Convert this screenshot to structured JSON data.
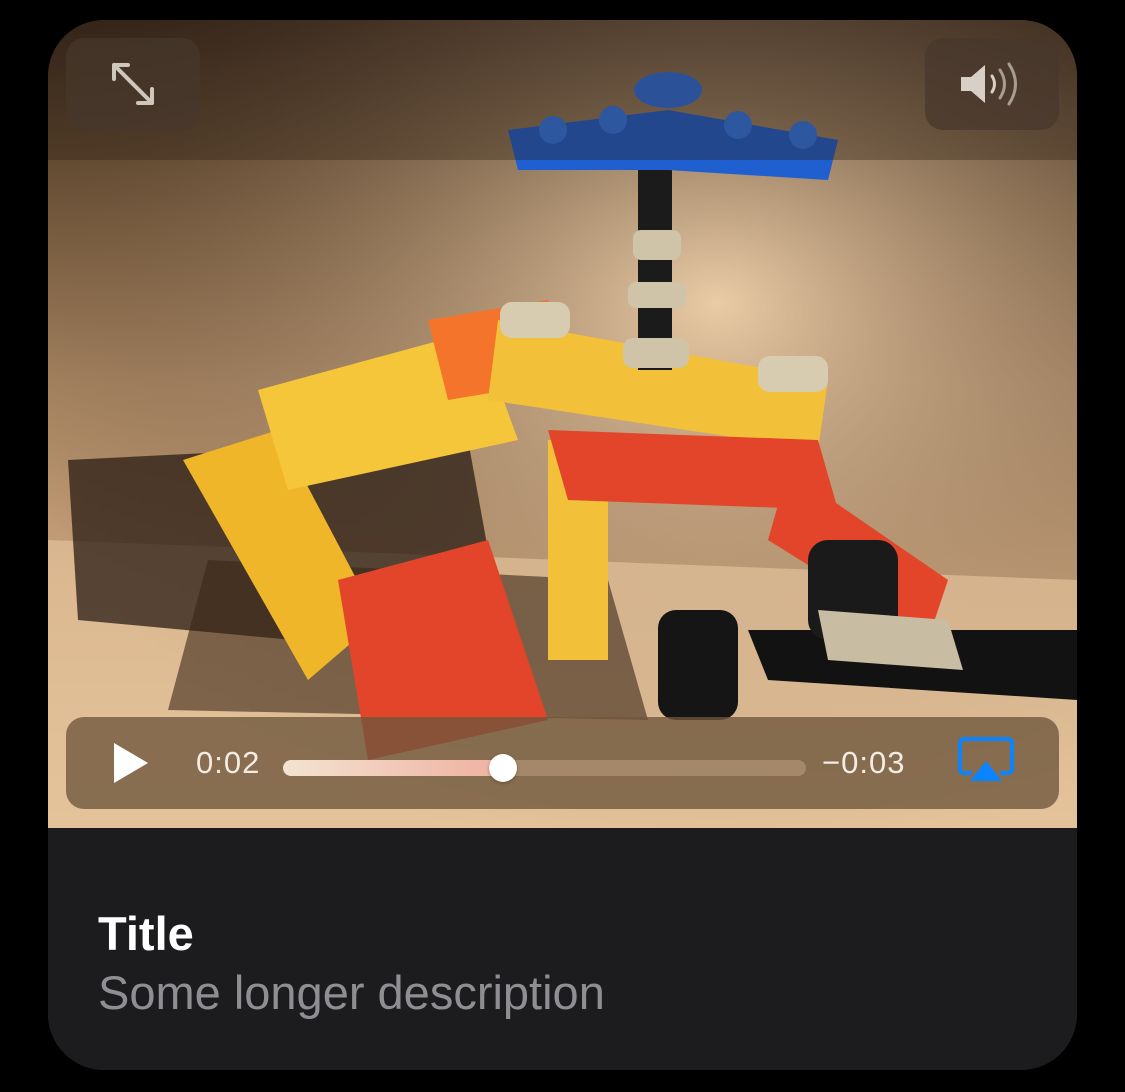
{
  "player": {
    "elapsed_time": "0:02",
    "remaining_time": "−0:03",
    "progress": 0.42,
    "accent_color": "#0a84ff"
  },
  "icons": {
    "fullscreen": "expand-arrows-icon",
    "volume": "speaker-volume-icon",
    "play": "play-icon",
    "airplay": "airplay-icon"
  },
  "info": {
    "title": "Title",
    "description": "Some longer description"
  }
}
